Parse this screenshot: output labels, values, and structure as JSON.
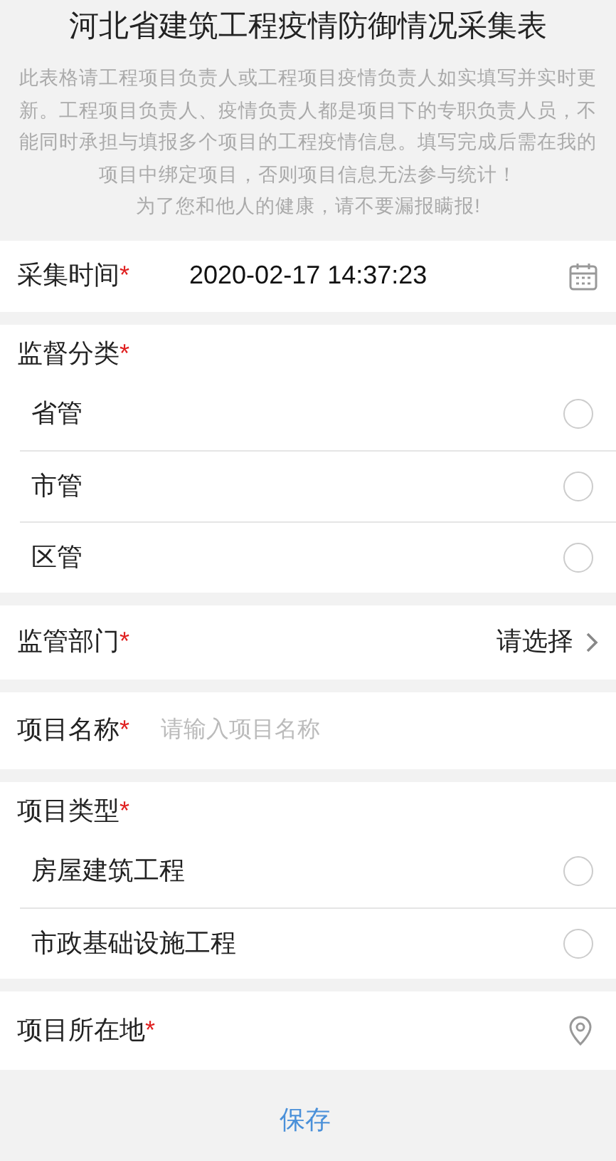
{
  "title": "河北省建筑工程疫情防御情况采集表",
  "notice": [
    "此表格请工程项目负责人或工程项目疫情负责人如实填写并实时更新。工程项目负责人、疫情负责人都是项目下的专职负责人员，不能同时承担与填报多个项目的工程疫情信息。填写完成后需在我的项目中绑定项目，否则项目信息无法参与统计！",
    "为了您和他人的健康，请不要漏报瞒报!"
  ],
  "fields": [
    {
      "kind": "datetime",
      "label": "采集时间",
      "required_mark": "*",
      "value": "2020-02-17 14:37:23"
    },
    {
      "kind": "radio_group",
      "label": "监督分类",
      "required_mark": "*",
      "options": [
        {
          "label": "省管",
          "selected": false
        },
        {
          "label": "市管",
          "selected": false
        },
        {
          "label": "区管",
          "selected": false
        }
      ]
    },
    {
      "kind": "select",
      "label": "监管部门",
      "required_mark": "*",
      "value": "请选择"
    },
    {
      "kind": "text",
      "label": "项目名称",
      "required_mark": "*",
      "placeholder": "请输入项目名称"
    },
    {
      "kind": "radio_group",
      "label": "项目类型",
      "required_mark": "*",
      "options": [
        {
          "label": "房屋建筑工程",
          "selected": false
        },
        {
          "label": "市政基础设施工程",
          "selected": false
        }
      ]
    },
    {
      "kind": "location",
      "label": "项目所在地",
      "required_mark": "*"
    }
  ],
  "save_button": "保存"
}
